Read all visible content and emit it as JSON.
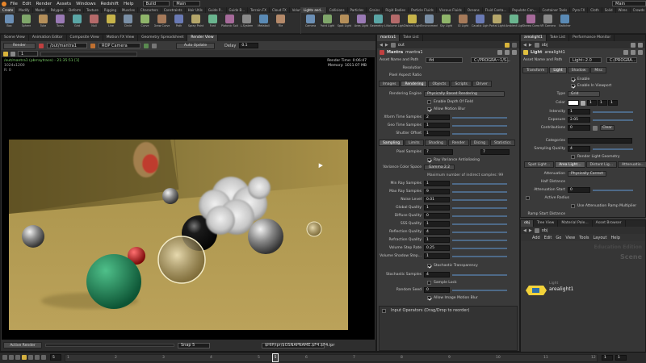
{
  "menu": [
    "File",
    "Edit",
    "Render",
    "Assets",
    "Windows",
    "Redshift",
    "Help"
  ],
  "desktop": {
    "build": "Build",
    "main": "Main",
    "main_right": "Main"
  },
  "shelf_left": {
    "tabs": [
      "Create",
      "Modify",
      "Model",
      "Polygon",
      "Deform",
      "Texture",
      "Rigging",
      "Muscles",
      "Characters",
      "Constraints",
      "Hair Utils",
      "Guide P...",
      "Guide B...",
      "Terrain FX",
      "Cloud FX",
      "Volume",
      "Redshift"
    ],
    "tools": [
      "Box",
      "Sphere",
      "Tube",
      "Torus",
      "Grid",
      "Null",
      "Line",
      "Circle",
      "Curve",
      "Draw Curve",
      "Path",
      "Spray Paint",
      "Font",
      "Platonic Solids",
      "L-System",
      "Metaball",
      "File"
    ]
  },
  "shelf_right": {
    "tabs": [
      "Lights and...",
      "Collisions",
      "Particles",
      "Grains",
      "Rigid Bodies",
      "Particle Fluids",
      "Viscous Fluids",
      "Oceans",
      "Fluid Conta...",
      "Populate Con...",
      "Container Tools",
      "Pyro FX",
      "Cloth",
      "Solid",
      "Wires",
      "Crowds",
      "Drive Simula..."
    ],
    "tools": [
      "Camera",
      "Point Light",
      "Spot Light",
      "Area Light",
      "Geometry Light",
      "Volume Light",
      "Distant Light",
      "Environment Light",
      "Sky Light",
      "GI Light",
      "Caustic Light",
      "Portal Light",
      "Ambient Light",
      "Stereo Camera",
      "VR Camera",
      "Switcher"
    ]
  },
  "left_panel": {
    "tabs": [
      "Scene View",
      "Animation Editor",
      "Composite View",
      "Motion FX View",
      "Geometry Spreadsheet",
      "Render View"
    ],
    "toolbar": {
      "render": "Render",
      "path": "/out/mantra1",
      "camera": "ROP Camera",
      "auto_update": "Auto Update",
      "delay_label": "Delay",
      "delay_value": "0.1",
      "frame": "1"
    },
    "info_top": "/out/mantra1 (pbrraytrace) - 21:35:51 [1]",
    "info_line2": "1024x1200",
    "info_line3": "R: 0",
    "render_time": "Render Time: 0:06:47",
    "memory": "Memory: 1011.07 MB",
    "bottom": {
      "active_render": "Active Render",
      "snap": "Snap 5",
      "output": "$HIP/ipr/$OSNAPNAME.$F4.$F4.ipr"
    }
  },
  "mid_panel": {
    "tabs": [
      "mantra1",
      "Take List"
    ],
    "path": "out",
    "node_type": "Mantra",
    "node_name": "mantra1",
    "asset": {
      "label": "Asset Name and Path",
      "value": "ifd",
      "path": "C:/PROGRA~1/S..."
    },
    "resolution_label": "Resolution",
    "pixel_aspect_label": "Pixel Aspect Ratio",
    "subtabs": [
      "Images",
      "Rendering",
      "Objects",
      "Scripts",
      "Driver"
    ],
    "rendering_engine": {
      "label": "Rendering Engine",
      "value": "Physically Based Rendering"
    },
    "enable_dof": "Enable Depth Of Field",
    "allow_motion_blur": "Allow Motion Blur",
    "xform_samples": {
      "label": "Xform Time Samples",
      "value": "2"
    },
    "geo_samples": {
      "label": "Geo Time Samples",
      "value": "1"
    },
    "shutter": {
      "label": "Shutter Offset",
      "value": "1"
    },
    "sampling_tabs": [
      "Sampling",
      "Limits",
      "Shading",
      "Render",
      "Dicing",
      "Statistics"
    ],
    "pixel_samples": {
      "label": "Pixel Samples",
      "v1": "7",
      "v2": "7"
    },
    "ray_var_aa": "Ray Variance Antialiasing",
    "color_space": {
      "label": "Variance Color Space",
      "value": "Gamma 2.2"
    },
    "max_samples_note": "Maximum number of indirect samples: 99",
    "params": [
      {
        "label": "Min Ray Samples",
        "value": "1"
      },
      {
        "label": "Max Ray Samples",
        "value": "9"
      },
      {
        "label": "Noise Level",
        "value": "0.01"
      },
      {
        "label": "Global Quality",
        "value": "1"
      },
      {
        "label": "Diffuse Quality",
        "value": "0"
      },
      {
        "label": "SSS Quality",
        "value": "1"
      },
      {
        "label": "Reflection Quality",
        "value": "4"
      },
      {
        "label": "Refraction Quality",
        "value": "1"
      },
      {
        "label": "Volume Step Rate",
        "value": "0.25"
      },
      {
        "label": "Volume Shadow Step...",
        "value": "1"
      }
    ],
    "stochastic_transparency": "Stochastic Transparency",
    "stochastic_samples": {
      "label": "Stochastic Samples",
      "value": "4"
    },
    "sample_lock": "Sample Lock",
    "random_seed": {
      "label": "Random Seed",
      "value": "0"
    },
    "allow_image_mb": "Allow Image Motion Blur",
    "input_operators": "Input Operators (Drag/Drop to reorder)"
  },
  "right_panel": {
    "tabs": [
      "arealight1",
      "Take List",
      "Performance Monitor"
    ],
    "path": "obj",
    "node_type": "Light",
    "node_name": "arealight1",
    "asset": {
      "label": "Asset Name and Path",
      "value": "Light::2.0",
      "path": "C:/PROGRA..."
    },
    "subtabs": [
      "Transform",
      "Light",
      "Shadow",
      "Misc"
    ],
    "enable": "Enable",
    "enable_viewport": "Enable In Viewport",
    "type": {
      "label": "Type",
      "value": "Grid"
    },
    "color": {
      "label": "Color",
      "r": "1",
      "g": "1",
      "b": "1"
    },
    "intensity": {
      "label": "Intensity",
      "value": "1"
    },
    "exposure": {
      "label": "Exposure",
      "value": "2.05"
    },
    "contributions": {
      "label": "Contributions",
      "value": "0",
      "clear": "Clear"
    },
    "categories": {
      "label": "Categories"
    },
    "sampling_quality": {
      "label": "Sampling Quality",
      "value": "4"
    },
    "render_light_geo": "Render Light Geometry",
    "light_tabs": [
      "Spot Light...",
      "Area Light...",
      "Distant Lig...",
      "Attenuatio..."
    ],
    "attenuation": {
      "label": "Attenuation",
      "value": "Physically Correct"
    },
    "half_distance": "Half Distance",
    "atten_start": {
      "label": "Attenuation Start",
      "value": "0"
    },
    "active_radius": "Active Radius",
    "use_ramp": "Use Attenuation Ramp Multiplier",
    "ramp_start": "Ramp Start Distance"
  },
  "network": {
    "tabs": [
      "obj",
      "Tree View",
      "Material Pale...",
      "Asset Browser"
    ],
    "path": "obj",
    "menu": [
      "Add",
      "Edit",
      "Go",
      "View",
      "Tools",
      "Layout",
      "Help"
    ],
    "watermark": "Education Edition",
    "scene": "Scene",
    "node_type": "Light",
    "node_name": "arealight1"
  },
  "timeline": {
    "current_frame": "5",
    "ticks": [
      "1",
      "2",
      "3",
      "4",
      "5",
      "6",
      "7",
      "8",
      "9",
      "10",
      "11",
      "12"
    ],
    "start": "1",
    "end": "1"
  }
}
